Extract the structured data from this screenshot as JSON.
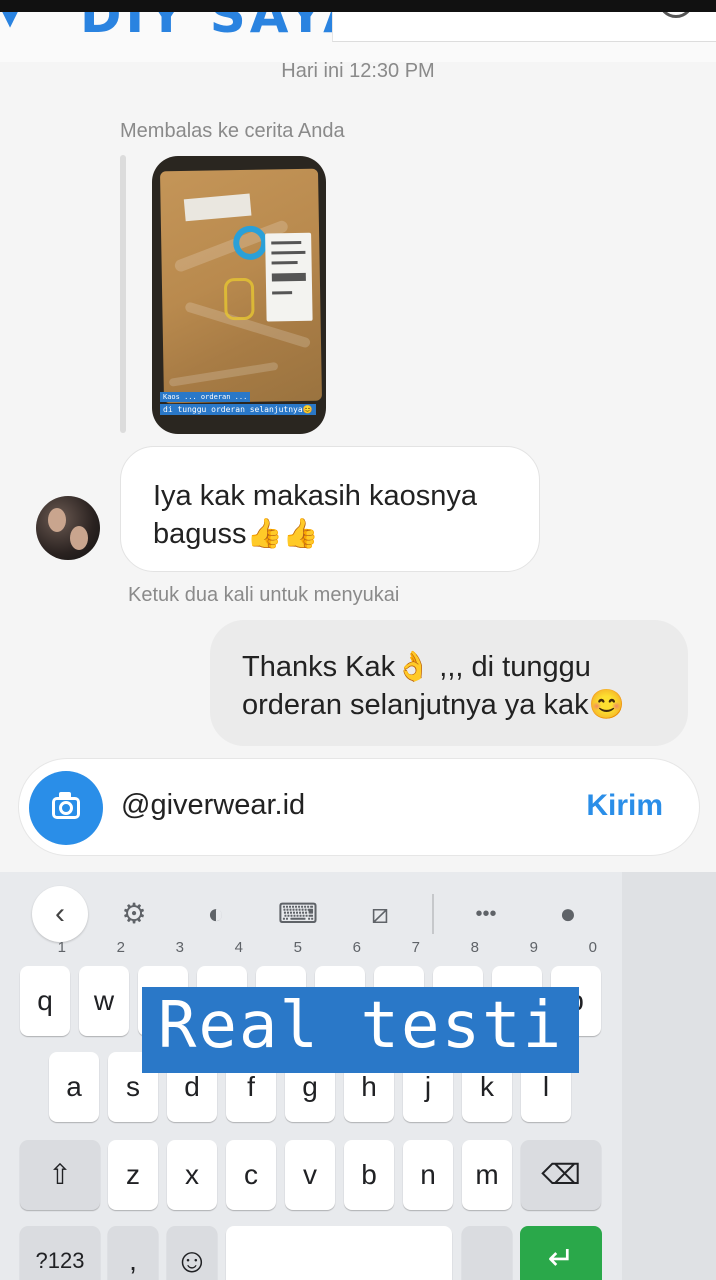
{
  "header": {
    "title": "DIY SAYA",
    "back_icon": "chevron-down-icon"
  },
  "conversation": {
    "timestamp": "Hari ini 12:30 PM",
    "reply_note": "Membalas ke cerita Anda",
    "story": {
      "caption_1": "Kaos ... orderan ... ",
      "caption_2": "di tunggu orderan selanjutnya😊"
    },
    "incoming_message": "Iya kak makasih kaosnya baguss👍👍",
    "like_hint": "Ketuk dua kali untuk menyukai",
    "outgoing_message": "Thanks Kak👌 ,,, di tunggu orderan selanjutnya ya kak😊"
  },
  "composer": {
    "input_value": "@giverwear.id",
    "send_label": "Kirim"
  },
  "keyboard": {
    "toolbar": {
      "back": "‹",
      "settings": "⚙",
      "theme": "◐",
      "keyboard": "⌨",
      "no_floating": "⧄",
      "more": "•••",
      "mic": "●"
    },
    "row1": [
      {
        "key": "q",
        "num": "1"
      },
      {
        "key": "w",
        "num": "2"
      },
      {
        "key": "e",
        "num": "3"
      },
      {
        "key": "r",
        "num": "4"
      },
      {
        "key": "t",
        "num": "5"
      },
      {
        "key": "y",
        "num": "6"
      },
      {
        "key": "u",
        "num": "7"
      },
      {
        "key": "i",
        "num": "8"
      },
      {
        "key": "o",
        "num": "9"
      },
      {
        "key": "p",
        "num": "0"
      }
    ],
    "row2": [
      "a",
      "s",
      "d",
      "f",
      "g",
      "h",
      "j",
      "k",
      "l"
    ],
    "row3": [
      "z",
      "x",
      "c",
      "v",
      "b",
      "n",
      "m"
    ],
    "shift": "⇧",
    "backspace": "⌫",
    "symbols": "?123",
    "comma": ",",
    "emoji": "☺",
    "enter": "↵",
    "side": {
      "expand": "⤢",
      "next": "›",
      "popout": "↗"
    }
  },
  "overlay_text": "Real testi"
}
